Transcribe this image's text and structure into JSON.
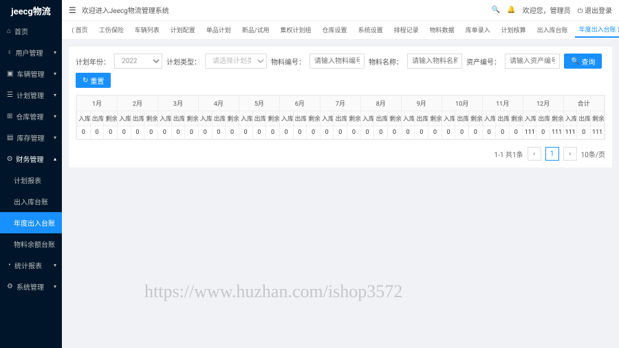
{
  "logo": "jeecg物流",
  "header": {
    "welcome": "欢迎进入Jeecg物流管理系统",
    "user": "欢迎您，管理员",
    "logout": "退出登录"
  },
  "sidebar": {
    "home": "首页",
    "user": "用户管理",
    "vehicle": "车辆管理",
    "plan": "计划管理",
    "warehouse": "仓库管理",
    "stock": "库存管理",
    "finance": "财务管理",
    "f1": "计划报表",
    "f2": "出入库台账",
    "f3": "年度出入台账",
    "f4": "物料余额台账",
    "stats": "统计报表",
    "system": "系统管理"
  },
  "tabs": [
    "首页",
    "工伤保险",
    "车辆列表",
    "计划配置",
    "单品计划",
    "新品/试用",
    "集权计划组",
    "仓库设置",
    "系统设置",
    "排程记录",
    "物料数据",
    "库单录入",
    "计划核算",
    "出入库台账",
    "年度出入台账"
  ],
  "tabActive": 14,
  "filters": {
    "yearLabel": "计划年份：",
    "year": "2022",
    "typeLabel": "计划类型：",
    "typePlaceholder": "请选择计划类型",
    "codeLabel": "物料编号：",
    "codePlaceholder": "请输入物料编号",
    "nameLabel": "物料名称：",
    "namePlaceholder": "请输入物料名称",
    "assetLabel": "资产编号：",
    "assetPlaceholder": "请输入资产编号",
    "search": "查询",
    "reset": "重置"
  },
  "months": [
    "1月",
    "2月",
    "3月",
    "4月",
    "5月",
    "6月",
    "7月",
    "8月",
    "9月",
    "10月",
    "11月",
    "12月",
    "合计"
  ],
  "subcols": [
    "入库",
    "出库",
    "剩余"
  ],
  "row": [
    0,
    0,
    0,
    0,
    0,
    0,
    0,
    0,
    0,
    0,
    0,
    0,
    0,
    0,
    0,
    0,
    0,
    0,
    0,
    0,
    0,
    0,
    0,
    0,
    0,
    0,
    0,
    0,
    0,
    0,
    0,
    0,
    0,
    111,
    0,
    111,
    111,
    0,
    111
  ],
  "pagination": {
    "info": "1-1 共1条",
    "page": "1",
    "size": "10条/页"
  },
  "watermark": "https://www.huzhan.com/ishop3572"
}
